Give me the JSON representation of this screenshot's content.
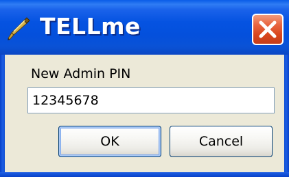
{
  "window": {
    "title": "TELLme",
    "icon": "pen-icon",
    "close_icon": "close-icon"
  },
  "dialog": {
    "field_label": "New Admin PIN",
    "pin_value": "12345678"
  },
  "buttons": {
    "ok_label": "OK",
    "cancel_label": "Cancel"
  },
  "colors": {
    "titlebar": "#0553e1",
    "close_button": "#e8643f",
    "client_background": "#ece9d8",
    "input_border": "#7f9db9",
    "button_border": "#003c74",
    "default_button_focus": "#7ea8ec"
  }
}
